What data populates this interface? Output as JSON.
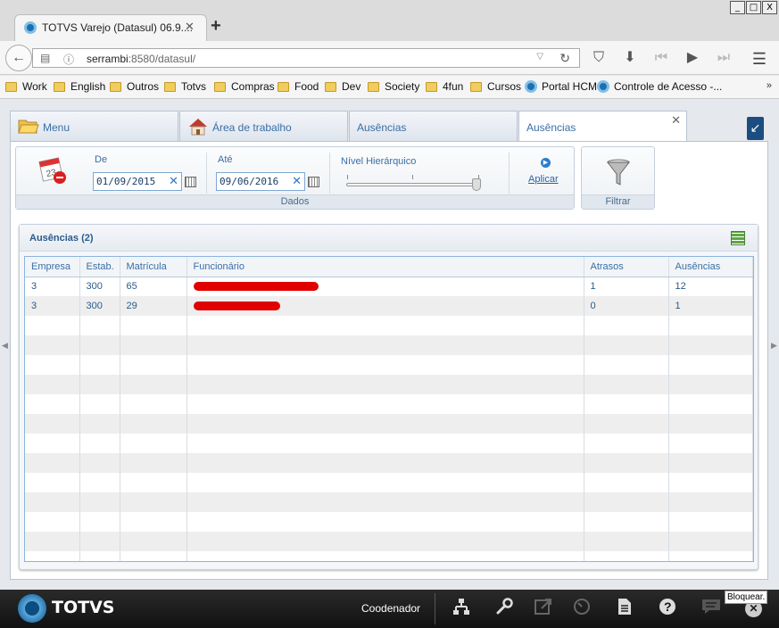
{
  "browser": {
    "tab_title": "TOTVS Varejo (Datasul) 06.9....",
    "url_host": "serrambi",
    "url_rest": ":8580/datasul/",
    "window_buttons": [
      "_",
      "□",
      "X"
    ]
  },
  "bookmarks": [
    {
      "label": "Work",
      "type": "folder"
    },
    {
      "label": "English",
      "type": "folder"
    },
    {
      "label": "Outros",
      "type": "folder"
    },
    {
      "label": "Totvs",
      "type": "folder"
    },
    {
      "label": "Compras",
      "type": "folder"
    },
    {
      "label": "Food",
      "type": "folder"
    },
    {
      "label": "Dev",
      "type": "folder"
    },
    {
      "label": "Society",
      "type": "folder"
    },
    {
      "label": "4fun",
      "type": "folder"
    },
    {
      "label": "Cursos",
      "type": "folder"
    },
    {
      "label": "Portal HCM",
      "type": "site"
    },
    {
      "label": "Controle de Acesso -...",
      "type": "site"
    }
  ],
  "app_tabs": {
    "menu": "Menu",
    "workspace": "Área de trabalho",
    "absences1": "Ausências",
    "absences2": "Ausências"
  },
  "filters": {
    "from_label": "De",
    "from_value": "01/09/2015",
    "to_label": "Até",
    "to_value": "09/06/2016",
    "level_label": "Nível Hierárquico",
    "apply_label": "Aplicar",
    "group_title": "Dados",
    "filter_label": "Filtrar"
  },
  "panel": {
    "title": "Ausências (2)"
  },
  "table": {
    "headers": [
      "Empresa",
      "Estab.",
      "Matrícula",
      "Funcionário",
      "Atrasos",
      "Ausências"
    ],
    "rows": [
      [
        "3",
        "300",
        "65",
        "",
        "1",
        "12"
      ],
      [
        "3",
        "300",
        "29",
        "",
        "0",
        "1"
      ]
    ]
  },
  "bottombar": {
    "brand": "TOTVS",
    "user": "Coodenador",
    "lock_tooltip": "Bloquear."
  },
  "colors": {
    "accent": "#3a6ea5",
    "redaction": "#e00000",
    "bottombar": "#1a1a1a"
  }
}
